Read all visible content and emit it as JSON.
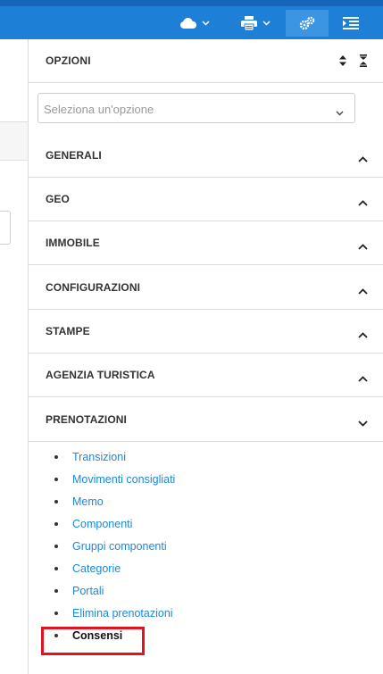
{
  "toolbar": {
    "cloud": {
      "icon": "cloud-icon",
      "menu_icon": "chevron-down-icon"
    },
    "print": {
      "icon": "printer-icon",
      "menu_icon": "chevron-down-icon"
    },
    "settings": {
      "icon": "gears-icon",
      "active": true
    },
    "panel_toggle": {
      "icon": "indent-list-icon"
    },
    "colors": {
      "bar": "#1d7fd6",
      "bar_top": "#1565b8",
      "active_button": "#3b95e2"
    }
  },
  "panel": {
    "title": "OPZIONI",
    "select": {
      "placeholder": "Seleziona un'opzione",
      "value": ""
    },
    "sections": [
      {
        "label": "GENERALI",
        "expanded": false
      },
      {
        "label": "GEO",
        "expanded": false
      },
      {
        "label": "IMMOBILE",
        "expanded": false
      },
      {
        "label": "CONFIGURAZIONI",
        "expanded": false
      },
      {
        "label": "STAMPE",
        "expanded": false
      },
      {
        "label": "AGENZIA TURISTICA",
        "expanded": false
      },
      {
        "label": "PRENOTAZIONI",
        "expanded": true
      }
    ],
    "links": [
      {
        "label": "Transizioni",
        "active": false
      },
      {
        "label": "Movimenti consigliati",
        "active": false
      },
      {
        "label": "Memo",
        "active": false
      },
      {
        "label": "Componenti",
        "active": false
      },
      {
        "label": "Gruppi componenti",
        "active": false
      },
      {
        "label": "Categorie",
        "active": false
      },
      {
        "label": "Portali",
        "active": false
      },
      {
        "label": "Elimina prenotazioni",
        "active": false
      },
      {
        "label": "Consensi",
        "active": true
      }
    ],
    "colors": {
      "link": "#1e88d8",
      "highlight": "#e0141f"
    }
  }
}
